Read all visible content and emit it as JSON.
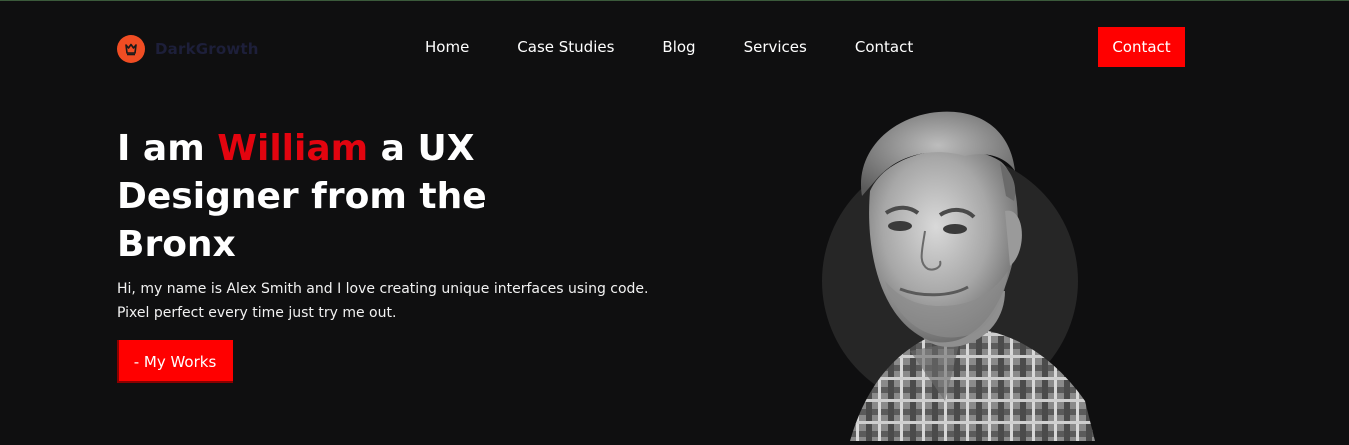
{
  "brand": {
    "name": "DarkGrowth",
    "logo_color": "#f04d23",
    "icon": "crown-icon"
  },
  "nav": {
    "items": [
      {
        "label": "Home"
      },
      {
        "label": "Case Studies"
      },
      {
        "label": "Blog"
      },
      {
        "label": "Services"
      },
      {
        "label": "Contact"
      }
    ],
    "cta_label": "Contact"
  },
  "hero": {
    "title_prefix": "I am ",
    "title_name": "William",
    "title_suffix": " a UX Designer from the Bronx",
    "description": "Hi, my name is Alex Smith and I love creating unique interfaces using code. Pixel perfect every time just try me out.",
    "button_label": "- My Works"
  },
  "colors": {
    "accent": "#ff0000",
    "background": "#0f0f10",
    "text": "#ffffff"
  }
}
